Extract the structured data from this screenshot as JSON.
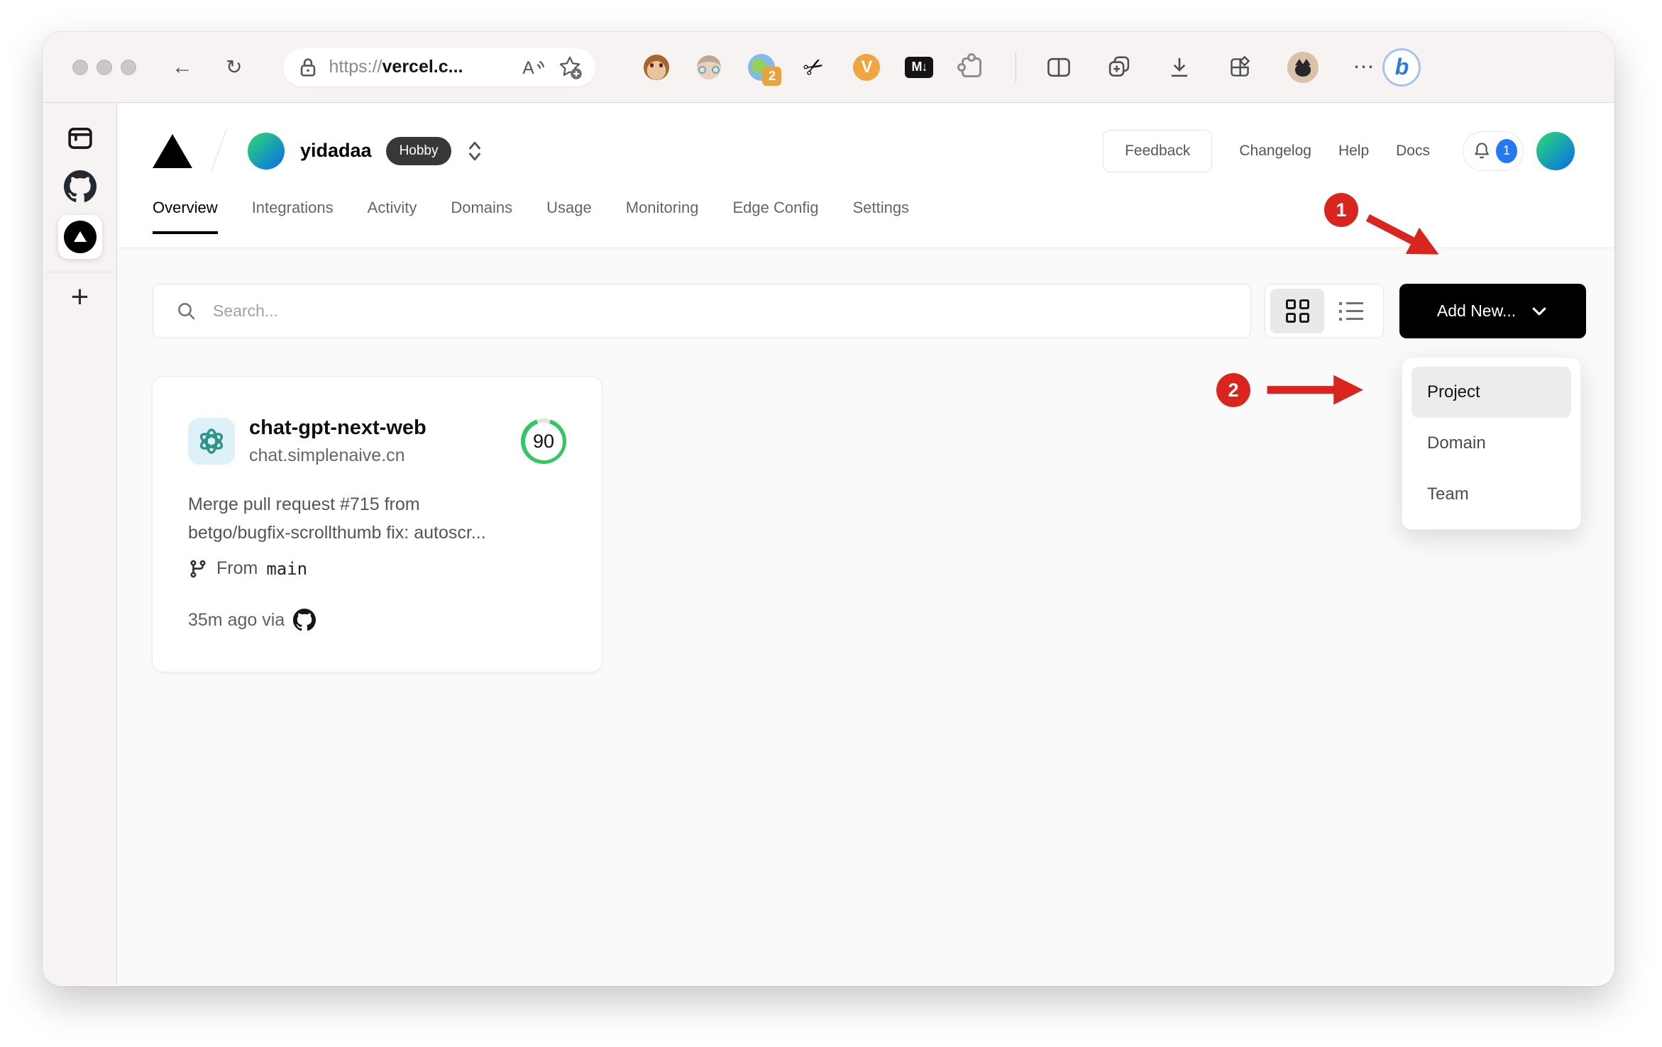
{
  "browser": {
    "url_scheme": "https://",
    "url_host": "vercel.c...",
    "extension_badge": "2",
    "vimium_label": "V",
    "markdown_label": "M↓",
    "bing_label": "b"
  },
  "vercel": {
    "account": {
      "name": "yidadaa",
      "plan": "Hobby"
    },
    "header_links": {
      "feedback": "Feedback",
      "changelog": "Changelog",
      "help": "Help",
      "docs": "Docs"
    },
    "notifications": "1",
    "nav": [
      {
        "label": "Overview",
        "active": true
      },
      {
        "label": "Integrations",
        "active": false
      },
      {
        "label": "Activity",
        "active": false
      },
      {
        "label": "Domains",
        "active": false
      },
      {
        "label": "Usage",
        "active": false
      },
      {
        "label": "Monitoring",
        "active": false
      },
      {
        "label": "Edge Config",
        "active": false
      },
      {
        "label": "Settings",
        "active": false
      }
    ],
    "search_placeholder": "Search...",
    "add_new_label": "Add New...",
    "dropdown": {
      "items": [
        {
          "label": "Project",
          "highlighted": true
        },
        {
          "label": "Domain",
          "highlighted": false
        },
        {
          "label": "Team",
          "highlighted": false
        }
      ]
    },
    "project": {
      "name": "chat-gpt-next-web",
      "domain": "chat.simplenaive.cn",
      "score": "90",
      "commit_line1": "Merge pull request #715 from",
      "commit_line2": "betgo/bugfix-scrollthumb fix: autoscr...",
      "branch_prefix": "From",
      "branch_name": "main",
      "deploy_meta": "35m ago via"
    }
  },
  "annotations": {
    "step1": "1",
    "step2": "2",
    "arrow_color": "#d9251d"
  },
  "colors": {
    "accent_blue": "#2478f2",
    "score_green": "#2fc863",
    "plan_badge_bg": "#383838",
    "annotation_red": "#d9251d"
  }
}
